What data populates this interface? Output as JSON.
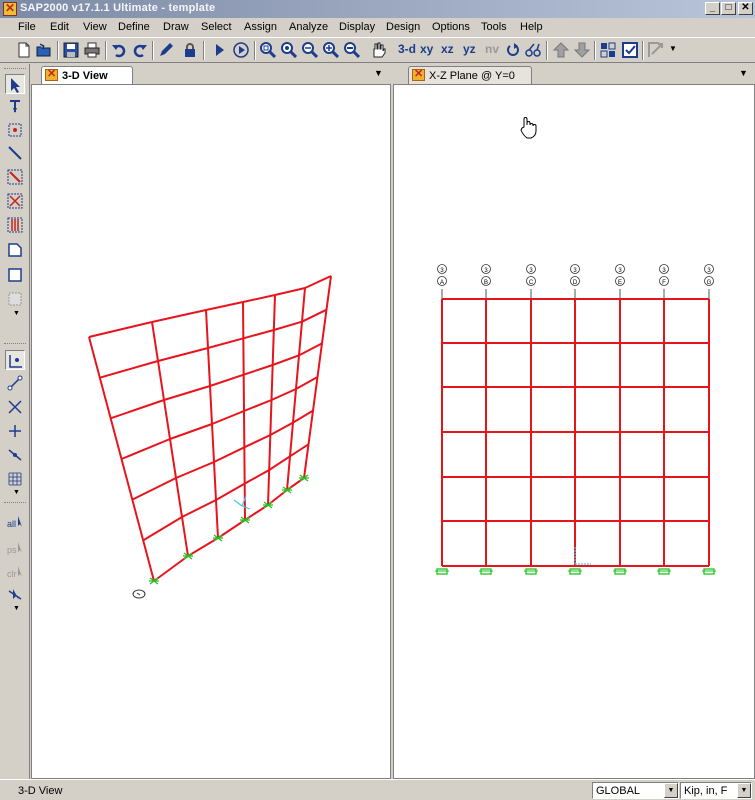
{
  "window": {
    "title": "SAP2000 v17.1.1 Ultimate  - template",
    "minimize": "_",
    "maximize": "□",
    "close": "✕"
  },
  "menu": [
    "File",
    "Edit",
    "View",
    "Define",
    "Draw",
    "Select",
    "Assign",
    "Analyze",
    "Display",
    "Design",
    "Options",
    "Tools",
    "Help"
  ],
  "toolbar": {
    "view_3d": "3-d",
    "view_xy": "xy",
    "view_xz": "xz",
    "view_yz": "yz",
    "view_nv": "nv",
    "icons": [
      "new-model-icon",
      "open-icon",
      "save-icon",
      "print-icon",
      "undo-icon",
      "redo-icon",
      "pencil-icon",
      "lock-icon",
      "run-analysis-icon",
      "run-options-icon",
      "zoom-window-icon",
      "zoom-restore-icon",
      "zoom-previous-icon",
      "zoom-in-icon",
      "zoom-out-icon",
      "pan-hand-icon",
      "rotate-icon",
      "perspective-icon",
      "move-up-icon",
      "move-down-icon",
      "object-shrink-icon",
      "set-display-icon",
      "assign-menu-icon"
    ]
  },
  "panes": {
    "left": {
      "tab_label": "3-D View"
    },
    "right": {
      "tab_label": "X-Z Plane @ Y=0"
    }
  },
  "grid_bubbles": {
    "top": [
      "3",
      "3",
      "3",
      "3",
      "3",
      "3",
      "3"
    ],
    "bottom": [
      "A",
      "B",
      "C",
      "D",
      "E",
      "F",
      "G"
    ]
  },
  "colors": {
    "frame": "#e8141c",
    "support": "#22c322",
    "axis": "#4ac6e8",
    "accent": "#1c3c8c"
  },
  "status": {
    "text": "3-D View",
    "coord_system": "GLOBAL",
    "units": "Kip, in, F"
  }
}
